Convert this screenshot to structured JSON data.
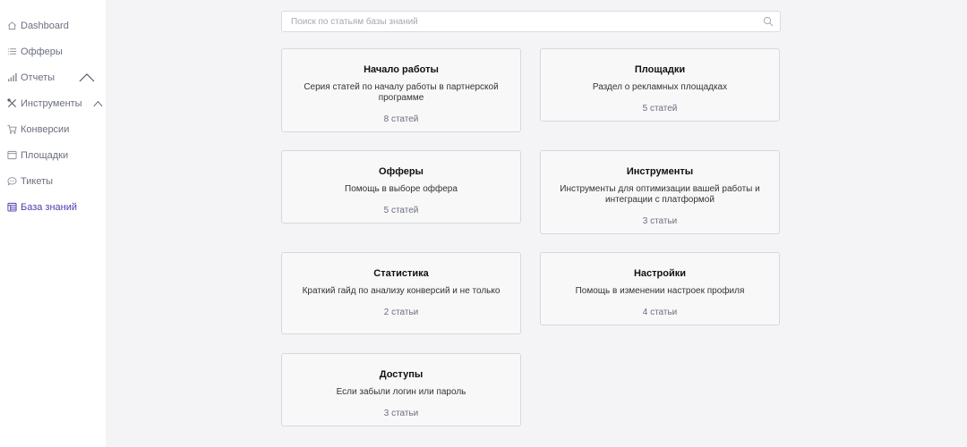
{
  "sidebar": {
    "items": [
      {
        "label": "Dashboard",
        "icon": "home-icon"
      },
      {
        "label": "Офферы",
        "icon": "list-icon"
      },
      {
        "label": "Отчеты",
        "icon": "bar-chart-icon"
      },
      {
        "label": "Инструменты",
        "icon": "tools-icon"
      },
      {
        "label": "Конверсии",
        "icon": "cart-icon"
      },
      {
        "label": "Площадки",
        "icon": "window-icon"
      },
      {
        "label": "Тикеты",
        "icon": "chat-icon"
      },
      {
        "label": "База знаний",
        "icon": "book-icon"
      }
    ],
    "active": "База знаний"
  },
  "search": {
    "placeholder": "Поиск по статьям базы знаний",
    "value": ""
  },
  "cards": [
    {
      "title": "Начало работы",
      "description": "Серия статей по началу работы в партнерской программе",
      "count": "8 статей"
    },
    {
      "title": "Площадки",
      "description": "Раздел о рекламных площадках",
      "count": "5 статей"
    },
    {
      "title": "Офферы",
      "description": "Помощь в выборе оффера",
      "count": "5 статей"
    },
    {
      "title": "Инструменты",
      "description": "Инструменты для оптимизации вашей работы и интеграции с платформой",
      "count": "3 статьи"
    },
    {
      "title": "Статистика",
      "description": "Краткий гайд по анализу конверсий и не только",
      "count": "2 статьи"
    },
    {
      "title": "Настройки",
      "description": "Помощь в изменении настроек профиля",
      "count": "4 статьи"
    },
    {
      "title": "Доступы",
      "description": "Если забыли логин или пароль",
      "count": "3 статьи"
    }
  ],
  "colors": {
    "accent": "#4a3fb0",
    "muted": "#6b6f80",
    "background": "#f4f4f6"
  }
}
